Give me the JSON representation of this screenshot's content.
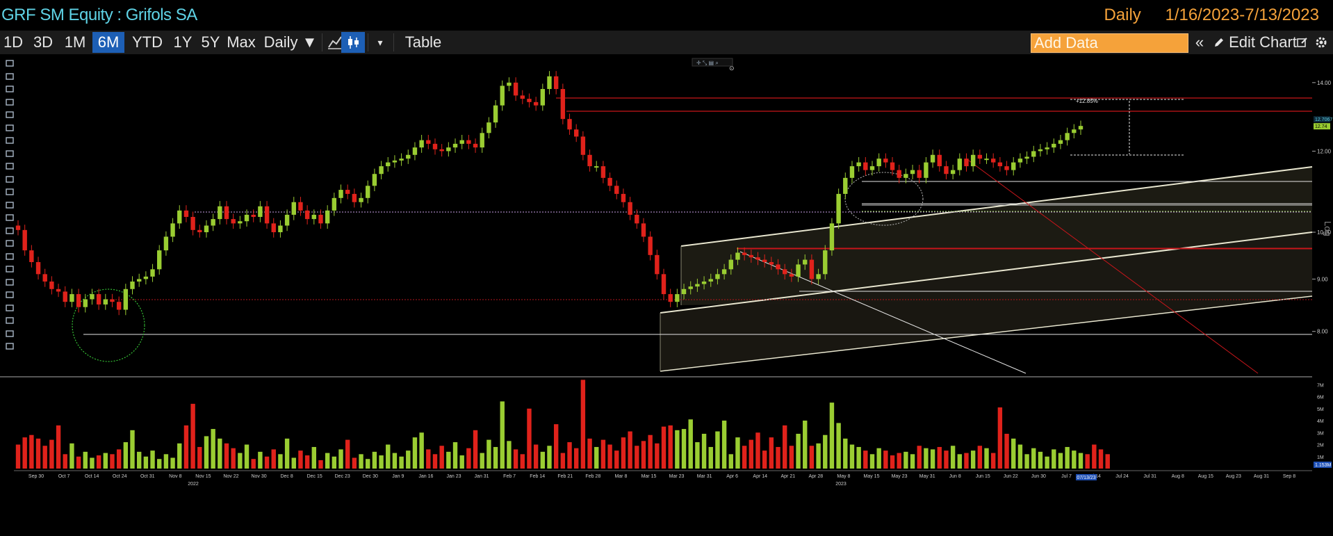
{
  "window": {
    "title": "GRF SM Equity : Grifols SA",
    "periodicity": "Daily",
    "date_range": "1/16/2023-7/13/2023"
  },
  "toolbar": {
    "ranges": [
      "1D",
      "3D",
      "1M",
      "6M",
      "YTD",
      "1Y",
      "5Y",
      "Max"
    ],
    "active_range": "6M",
    "frequency": "Daily ▼",
    "table_label": "Table",
    "add_data_placeholder": "Add Data",
    "edit_chart_label": "Edit Chart",
    "icons": [
      "line-chart-icon",
      "candlestick-icon",
      "dropdown-arrow-icon",
      "collapse-left-icon",
      "pencil-icon",
      "edit-icon",
      "gear-icon"
    ]
  },
  "left_tools": [
    "pointer-icon",
    "pen-icon",
    "ruler-icon",
    "brush-icon",
    "ruler-icon",
    "line-icon",
    "pencil-icon",
    "line-icon",
    "pencil-icon",
    "text-icon",
    "line-icon",
    "move-icon",
    "pointer-icon",
    "trash-icon",
    "text-icon",
    "square-icon",
    "list-icon",
    "list-icon",
    "ruler-icon",
    "gear-icon",
    "globe-icon",
    "palette-icon",
    "gear-icon"
  ],
  "price_axis": {
    "ticks": [
      "14.00",
      "12.00",
      "10.00",
      "9.00",
      "8.00"
    ],
    "last_price_labels": [
      "12.7067",
      "12.74"
    ],
    "scale_label": "Log"
  },
  "measure_label": "+12.85%",
  "volume_axis": {
    "ticks": [
      "7M",
      "6M",
      "5M",
      "4M",
      "3M",
      "2M",
      "1M"
    ],
    "last_volume_label": "1.153M"
  },
  "x_axis": {
    "labels": [
      "Sep 30",
      "Oct 7",
      "Oct 14",
      "Oct 24",
      "Oct 31",
      "Nov 8",
      "Nov 15",
      "Nov 22",
      "Nov 30",
      "Dec 8",
      "Dec 15",
      "Dec 23",
      "Dec 30",
      "Jan 9",
      "Jan 16",
      "Jan 23",
      "Jan 31",
      "Feb 7",
      "Feb 14",
      "Feb 21",
      "Feb 28",
      "Mar 8",
      "Mar 15",
      "Mar 23",
      "Mar 31",
      "Apr 6",
      "Apr 14",
      "Apr 21",
      "Apr 28",
      "May 8",
      "May 15",
      "May 23",
      "May 31",
      "Jun 8",
      "Jun 15",
      "Jun 22",
      "Jun 30",
      "Jul 7",
      "Jul 14",
      "Jul 24",
      "Jul 31",
      "Aug 8",
      "Aug 15",
      "Aug 23",
      "Aug 31",
      "Sep 8"
    ],
    "years": [
      "2022",
      "2023"
    ],
    "current_date": "07/13/23"
  },
  "colors": {
    "up": "#9acd32",
    "down": "#e0221b",
    "accent": "#f5a23a",
    "title": "#5fd3e6",
    "active": "#1d5fb5"
  },
  "chart_data": {
    "type": "candlestick",
    "scale": "log",
    "ylim": [
      7.5,
      14.6
    ],
    "ylabel": "Log",
    "series": [
      {
        "name": "price_close",
        "values": [
          10.05,
          9.6,
          9.35,
          9.1,
          8.95,
          8.8,
          8.75,
          8.55,
          8.7,
          8.45,
          8.6,
          8.7,
          8.5,
          8.6,
          8.55,
          8.4,
          8.8,
          8.95,
          9.0,
          9.05,
          9.2,
          9.6,
          9.9,
          10.2,
          10.5,
          10.35,
          10.05,
          10.0,
          10.15,
          10.3,
          10.6,
          10.3,
          10.2,
          10.25,
          10.4,
          10.35,
          10.6,
          10.2,
          10.0,
          10.15,
          10.4,
          10.7,
          10.5,
          10.3,
          10.4,
          10.2,
          10.5,
          10.8,
          11.0,
          10.9,
          10.7,
          10.8,
          11.1,
          11.4,
          11.6,
          11.7,
          11.75,
          11.8,
          11.9,
          12.1,
          12.3,
          12.2,
          12.05,
          12.0,
          12.1,
          12.2,
          12.3,
          12.2,
          12.1,
          12.5,
          12.8,
          13.3,
          13.9,
          14.0,
          13.6,
          13.5,
          13.4,
          13.3,
          13.8,
          14.2,
          13.8,
          12.9,
          12.6,
          12.4,
          11.9,
          11.6,
          11.6,
          11.3,
          11.1,
          10.9,
          10.7,
          10.4,
          10.2,
          9.9,
          9.5,
          9.1,
          8.7,
          8.55,
          8.7,
          8.8,
          8.85,
          8.9,
          8.95,
          9.0,
          9.1,
          9.2,
          9.4,
          9.55,
          9.5,
          9.45,
          9.4,
          9.35,
          9.3,
          9.2,
          9.1,
          9.05,
          9.3,
          9.4,
          9.0,
          9.1,
          9.6,
          10.2,
          10.9,
          11.3,
          11.6,
          11.7,
          11.5,
          11.6,
          11.8,
          11.7,
          11.5,
          11.3,
          11.4,
          11.5,
          11.3,
          11.7,
          11.9,
          11.6,
          11.4,
          11.5,
          11.8,
          11.6,
          11.9,
          11.8,
          11.8,
          11.7,
          11.6,
          11.5,
          11.7,
          11.8,
          11.85,
          12.0,
          12.05,
          12.1,
          12.2,
          12.3,
          12.5,
          12.6,
          12.7
        ]
      },
      {
        "name": "volume",
        "values": [
          2.0,
          2.6,
          2.8,
          2.5,
          1.9,
          2.4,
          3.6,
          1.2,
          2.1,
          1.0,
          1.4,
          0.9,
          1.1,
          1.3,
          1.2,
          1.6,
          2.2,
          3.2,
          1.4,
          1.0,
          1.5,
          0.8,
          1.2,
          0.9,
          2.1,
          3.6,
          5.4,
          1.8,
          2.7,
          3.3,
          2.5,
          2.1,
          1.7,
          1.3,
          2.0,
          0.8,
          1.4,
          1.0,
          1.6,
          1.2,
          2.5,
          0.9,
          1.5,
          1.1,
          1.8,
          0.7,
          1.3,
          1.0,
          1.6,
          2.4,
          0.9,
          1.2,
          0.8,
          1.4,
          1.1,
          2.0,
          1.3,
          1.0,
          1.5,
          2.6,
          3.0,
          1.6,
          1.2,
          1.9,
          1.4,
          2.2,
          1.1,
          1.7,
          3.2,
          1.3,
          2.4,
          1.8,
          5.6,
          2.3,
          1.6,
          1.2,
          5.0,
          2.0,
          1.4,
          1.9,
          3.7,
          1.3,
          2.2,
          1.7,
          7.4,
          2.5,
          1.8,
          2.4,
          2.0,
          1.5,
          2.6,
          3.1,
          1.9,
          2.3,
          2.8,
          2.1,
          3.5,
          3.6,
          3.2,
          3.3,
          4.1,
          2.2,
          2.9,
          1.8,
          3.1,
          4.0,
          1.2,
          2.6,
          1.9,
          2.4,
          3.0,
          1.5,
          2.6,
          1.8,
          3.6,
          1.9,
          2.9,
          4.0,
          1.9,
          2.1,
          2.8,
          5.5,
          3.8,
          2.5,
          2.0,
          1.8,
          1.5,
          1.2,
          1.7,
          1.5,
          1.1,
          1.3,
          1.4,
          1.2,
          1.9,
          1.7,
          1.6,
          1.8,
          1.5,
          1.9,
          1.2,
          1.3,
          1.5,
          1.9,
          1.7,
          1.3,
          5.1,
          2.9,
          2.5,
          2.0,
          1.2,
          1.7,
          1.4,
          1.0,
          1.6,
          1.3,
          1.8,
          1.5,
          1.3,
          1.2,
          2.0,
          1.6,
          1.2
        ]
      }
    ],
    "annotations": [
      "+12.85%"
    ]
  }
}
